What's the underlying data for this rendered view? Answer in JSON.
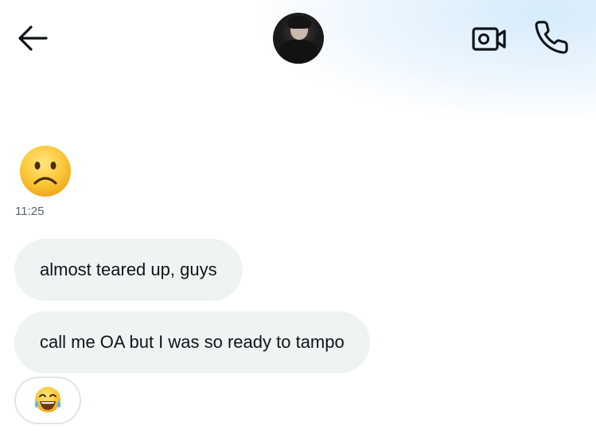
{
  "header": {
    "back_icon": "arrow-left-icon",
    "avatar": "contact-avatar",
    "video_icon": "video-call-icon",
    "call_icon": "phone-icon"
  },
  "messages": [
    {
      "type": "emoji",
      "emoji": "☹️",
      "icon": "frowning-face-emoji",
      "time": "11:25"
    },
    {
      "type": "text",
      "text": "almost teared up, guys"
    },
    {
      "type": "text",
      "text": "call me OA but I was so ready to tampo",
      "reaction": "😂",
      "reaction_icon": "tears-of-joy-emoji"
    }
  ],
  "colors": {
    "bubble_bg": "#eff3f4",
    "text": "#0f1419",
    "secondary_text": "#536471",
    "header_glow": "#d5ebfb"
  }
}
